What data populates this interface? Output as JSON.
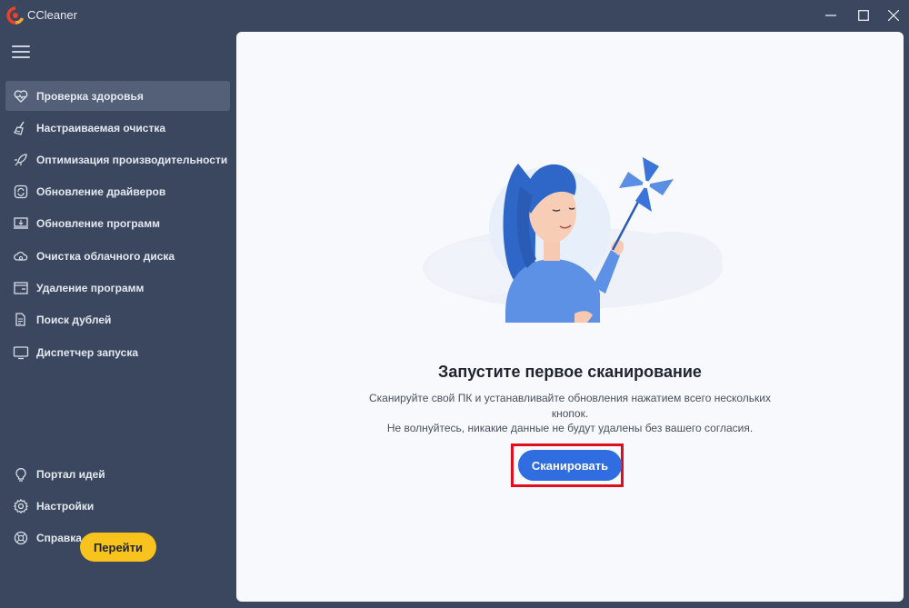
{
  "app": {
    "title": "CCleaner"
  },
  "window": {
    "minimize_icon": "minimize-icon",
    "maximize_icon": "maximize-icon",
    "close_icon": "close-icon"
  },
  "sidebar": {
    "menu_icon": "hamburger-icon",
    "items": [
      {
        "label": "Проверка здоровья",
        "icon": "heart-icon",
        "active": true
      },
      {
        "label": "Настраиваемая очистка",
        "icon": "broom-icon"
      },
      {
        "label": "Оптимизация производительности",
        "icon": "rocket-icon"
      },
      {
        "label": "Обновление драйверов",
        "icon": "driver-update-icon"
      },
      {
        "label": "Обновление программ",
        "icon": "software-update-icon"
      },
      {
        "label": "Очистка облачного диска",
        "icon": "cloud-icon"
      },
      {
        "label": "Удаление программ",
        "icon": "uninstall-icon"
      },
      {
        "label": "Поиск дублей",
        "icon": "duplicate-icon"
      },
      {
        "label": "Диспетчер запуска",
        "icon": "monitor-icon"
      }
    ],
    "bottom_items": [
      {
        "label": "Портал идей",
        "icon": "lightbulb-icon"
      },
      {
        "label": "Настройки",
        "icon": "gear-icon"
      },
      {
        "label": "Справка",
        "icon": "help-icon"
      }
    ],
    "go_button": "Перейти"
  },
  "main": {
    "heading": "Запустите первое сканирование",
    "description_line1": "Сканируйте свой ПК и устанавливайте обновления нажатием всего нескольких кнопок.",
    "description_line2": "Не волнуйтесь, никакие данные не будут удалены без вашего согласия.",
    "scan_button": "Сканировать"
  },
  "colors": {
    "sidebar_bg": "#3a475e",
    "active_item_bg": "#536078",
    "main_bg": "#f7f9fc",
    "primary_button": "#2f6de1",
    "go_button": "#f8c31c",
    "highlight": "#e00d1f"
  }
}
